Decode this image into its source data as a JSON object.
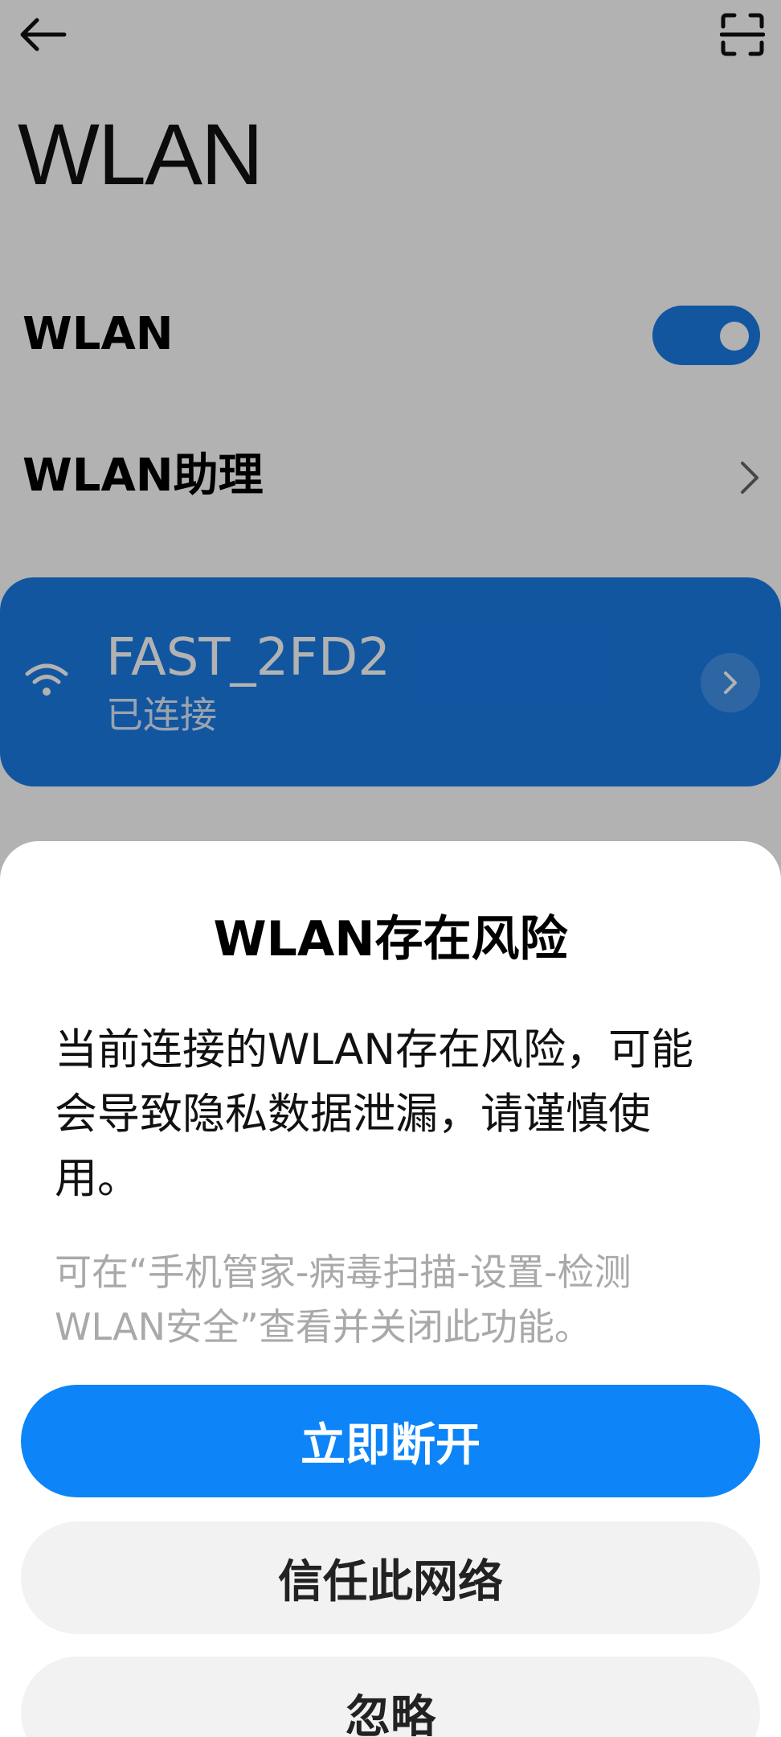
{
  "header": {
    "back_icon": "arrow-left-icon",
    "scan_icon": "scan-icon"
  },
  "page": {
    "title": "WLAN"
  },
  "settings": {
    "wlan_label": "WLAN",
    "wlan_enabled": true,
    "assistant_label": "WLAN助理"
  },
  "network": {
    "name": "FAST_2FD2",
    "status": "已连接",
    "icon": "wifi-icon"
  },
  "dialog": {
    "title": "WLAN存在风险",
    "message": "当前连接的WLAN存在风险，可能会导致隐私数据泄漏，请谨慎使用。",
    "hint": "可在“手机管家-病毒扫描-设置-检测WLAN安全”查看并关闭此功能。",
    "buttons": {
      "disconnect": "立即断开",
      "trust": "信任此网络",
      "ignore": "忽略"
    }
  },
  "colors": {
    "accent": "#1a7be6",
    "primary_button": "#0d84f7",
    "secondary_button": "#f2f2f2",
    "hint_text": "#a9a9a9"
  }
}
